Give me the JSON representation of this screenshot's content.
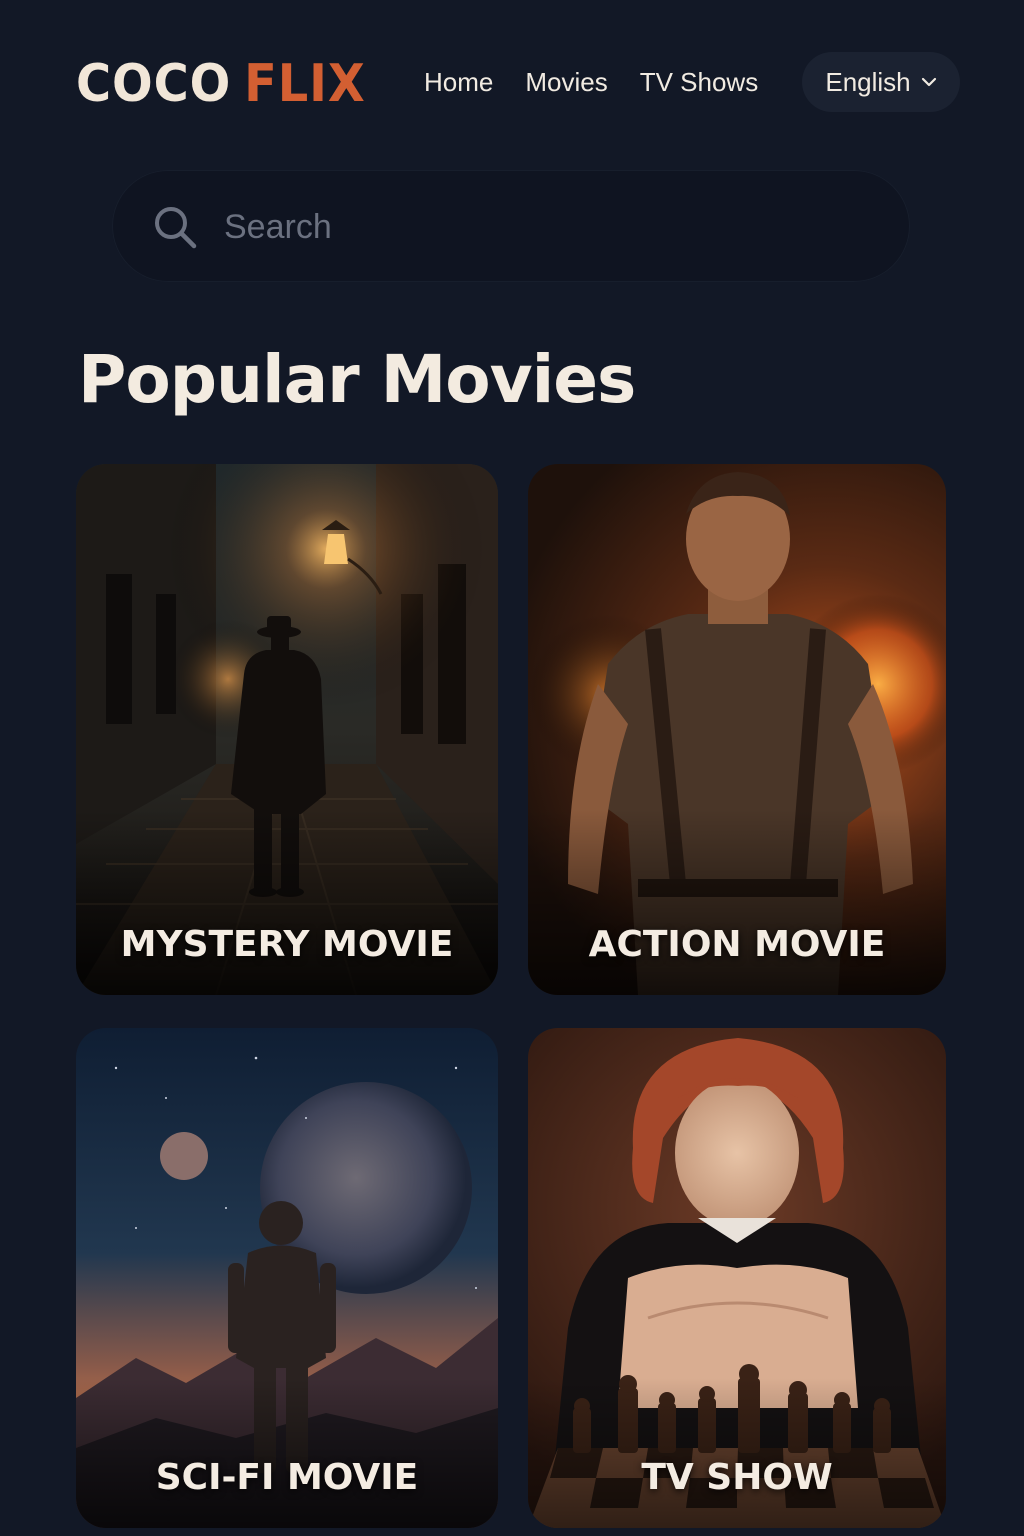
{
  "header": {
    "logo": {
      "part1": "COCO",
      "part2": "FLIX"
    },
    "nav": [
      {
        "label": "Home"
      },
      {
        "label": "Movies"
      },
      {
        "label": "TV Shows"
      }
    ],
    "language": {
      "label": "English"
    }
  },
  "search": {
    "placeholder": "Search",
    "value": ""
  },
  "section": {
    "title": "Popular Movies"
  },
  "cards": [
    {
      "label": "MYSTERY MOVIE"
    },
    {
      "label": "ACTION MOVIE"
    },
    {
      "label": "SCI-FI MOVIE"
    },
    {
      "label": "TV SHOW"
    }
  ],
  "colors": {
    "background": "#121826",
    "accent": "#d35f32",
    "logo_primary": "#f1e6d8",
    "text": "#f3ebe0",
    "search_bg": "#0f1421",
    "placeholder": "#6b7180"
  },
  "icons": {
    "search": "search-icon",
    "language_dropdown": "chevron-down-icon"
  }
}
